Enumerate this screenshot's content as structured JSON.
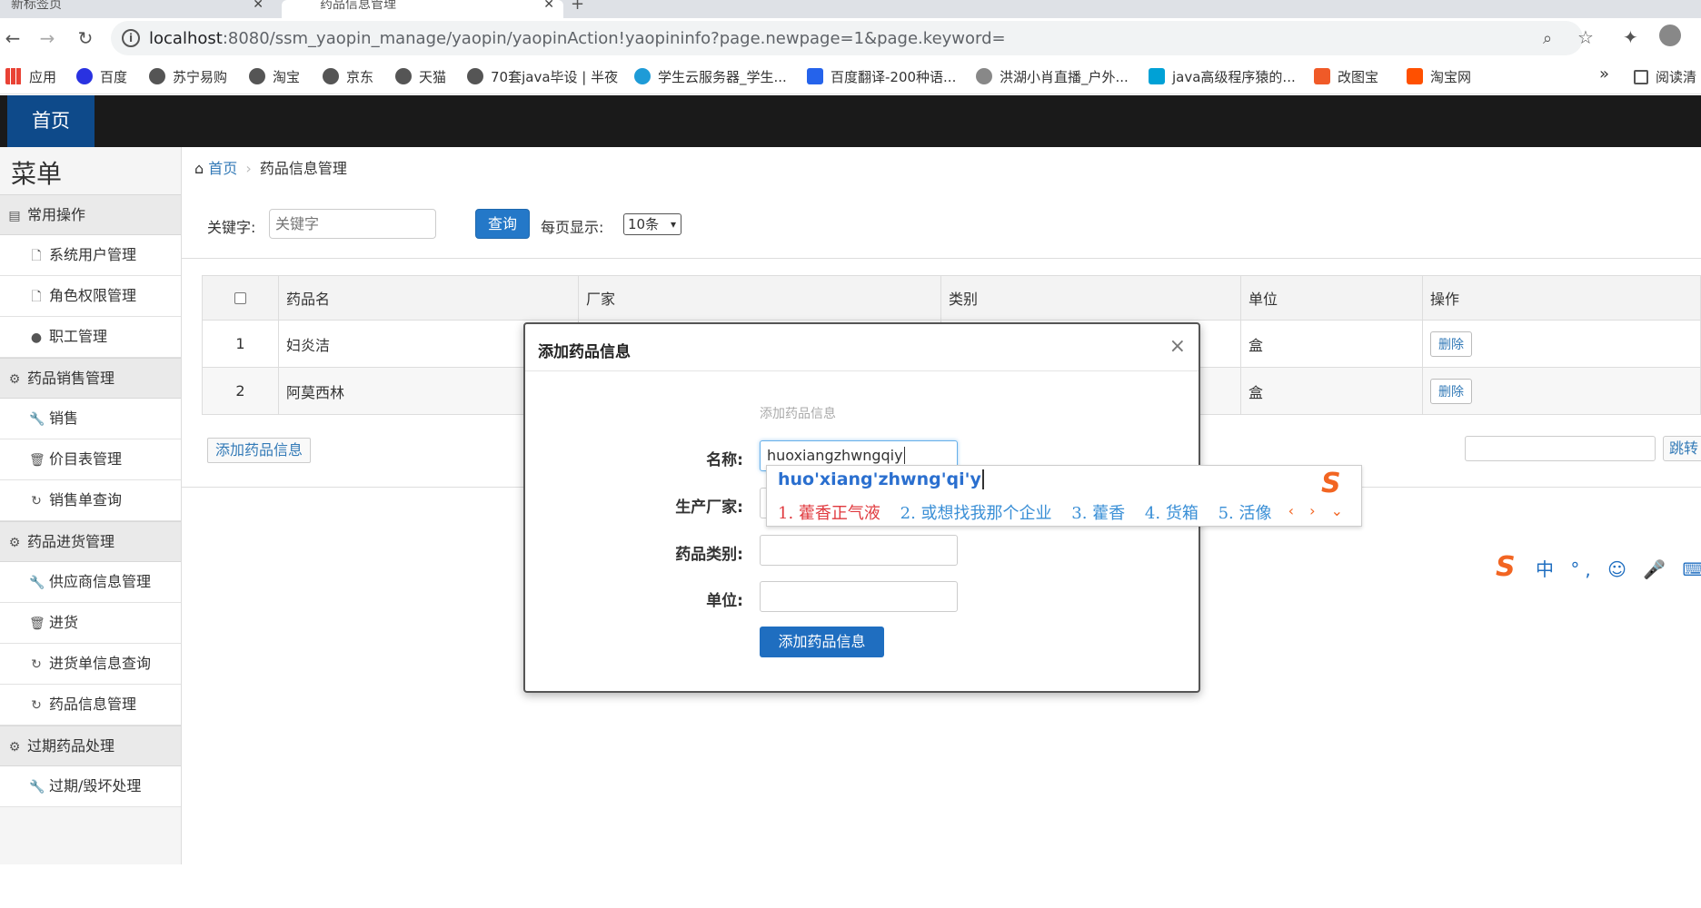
{
  "browser": {
    "tabs": [
      {
        "title": "新标签页"
      },
      {
        "title": "药品信息管理"
      }
    ],
    "new_tab_symbol": "+",
    "url_host": "localhost",
    "url_path": ":8080/ssm_yaopin_manage/yaopin/yaopinAction!yaopininfo?page.newpage=1&page.keyword=",
    "bookmarks": [
      {
        "label": "应用",
        "color": "#e94235"
      },
      {
        "label": "百度",
        "color": "#2932e1"
      },
      {
        "label": "苏宁易购",
        "color": "#555555"
      },
      {
        "label": "淘宝",
        "color": "#555555"
      },
      {
        "label": "京东",
        "color": "#555555"
      },
      {
        "label": "天猫",
        "color": "#555555"
      },
      {
        "label": "70套java毕设 | 半夜",
        "color": "#555555"
      },
      {
        "label": "学生云服务器_学生...",
        "color": "#1e9bd7"
      },
      {
        "label": "百度翻译-200种语...",
        "color": "#2563eb"
      },
      {
        "label": "洪湖小肖直播_户外...",
        "color": "#888888"
      },
      {
        "label": "java高级程序猿的...",
        "color": "#00a1d6"
      },
      {
        "label": "改图宝",
        "color": "#f05a28"
      },
      {
        "label": "淘宝网",
        "color": "#ff5000"
      }
    ],
    "more_bookmarks": "»",
    "reading_list": "阅读清"
  },
  "app": {
    "home_tab": "首页",
    "menu_title": "菜单",
    "sidebar": [
      {
        "type": "group",
        "label": "常用操作",
        "icon": "list-icon"
      },
      {
        "type": "item",
        "label": "系统用户管理",
        "icon": "file-icon"
      },
      {
        "type": "item",
        "label": "角色权限管理",
        "icon": "file-icon"
      },
      {
        "type": "item",
        "label": "职工管理",
        "icon": "comment-icon"
      },
      {
        "type": "group",
        "label": "药品销售管理",
        "icon": "gear-icon"
      },
      {
        "type": "item",
        "label": "销售",
        "icon": "wrench-icon"
      },
      {
        "type": "item",
        "label": "价目表管理",
        "icon": "trash-icon"
      },
      {
        "type": "item",
        "label": "销售单查询",
        "icon": "refresh-icon"
      },
      {
        "type": "group",
        "label": "药品进货管理",
        "icon": "gear-icon"
      },
      {
        "type": "item",
        "label": "供应商信息管理",
        "icon": "wrench-icon"
      },
      {
        "type": "item",
        "label": "进货",
        "icon": "trash-icon"
      },
      {
        "type": "item",
        "label": "进货单信息查询",
        "icon": "refresh-icon"
      },
      {
        "type": "item",
        "label": "药品信息管理",
        "icon": "refresh-icon"
      },
      {
        "type": "group",
        "label": "过期药品处理",
        "icon": "gear-icon"
      },
      {
        "type": "item",
        "label": "过期/毁坏处理",
        "icon": "wrench-icon"
      }
    ],
    "breadcrumb": {
      "home": "首页",
      "separator": "›",
      "current": "药品信息管理"
    },
    "search": {
      "keyword_label": "关键字:",
      "keyword_placeholder": "关键字",
      "query_button": "查询",
      "per_page_label": "每页显示:",
      "per_page_value": "10条"
    },
    "table": {
      "headers": [
        "",
        "药品名",
        "厂家",
        "类别",
        "单位",
        "操作"
      ],
      "rows": [
        {
          "no": "1",
          "name": "妇炎洁",
          "factory": "",
          "category": "",
          "unit": "盒",
          "action": "删除"
        },
        {
          "no": "2",
          "name": "阿莫西林",
          "factory": "",
          "category": "",
          "unit": "盒",
          "action": "删除"
        }
      ]
    },
    "add_button": "添加药品信息",
    "jump_button": "跳转"
  },
  "modal": {
    "title": "添加药品信息",
    "close": "×",
    "subtitle": "添加药品信息",
    "fields": [
      {
        "label": "名称:",
        "value": "huoxiangzhwngqiy"
      },
      {
        "label": "生产厂家:",
        "value": ""
      },
      {
        "label": "药品类别:",
        "value": ""
      },
      {
        "label": "单位:",
        "value": ""
      }
    ],
    "submit": "添加药品信息"
  },
  "ime": {
    "composition": "huo'xiang'zhwng'qi'y",
    "candidates": [
      "1. 藿香正气液",
      "2. 或想找我那个企业",
      "3. 藿香",
      "4. 货箱",
      "5. 活像"
    ],
    "logo": "S",
    "nav": "‹ › ⌄",
    "toolbar_logo": "S",
    "toolbar_text": "中 °, ☺ 🎤 ⌨ 👕"
  }
}
